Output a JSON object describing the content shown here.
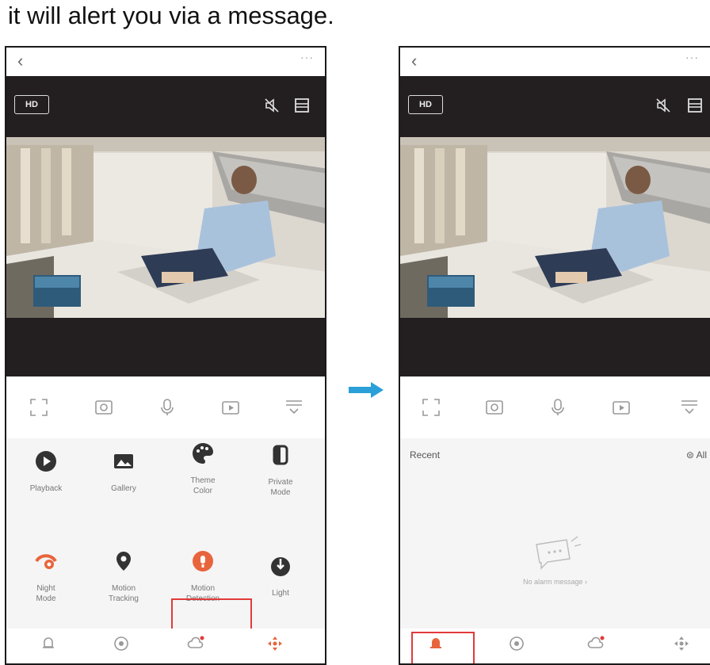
{
  "instruction": "it will alert you via a message.",
  "phone_left": {
    "back_glyph": "‹",
    "more_glyph": "···",
    "hd_label": "HD",
    "features": [
      {
        "label": "Playback",
        "icon": "play-circle-icon"
      },
      {
        "label": "Gallery",
        "icon": "image-icon"
      },
      {
        "label": "Theme\nColor",
        "icon": "palette-icon"
      },
      {
        "label": "Private\nMode",
        "icon": "half-circle-icon"
      },
      {
        "label": "Night\nMode",
        "icon": "eye-off-icon"
      },
      {
        "label": "Motion\nTracking",
        "icon": "location-pin-icon"
      },
      {
        "label": "Motion\nDetection",
        "icon": "motion-detection-icon"
      },
      {
        "label": "Light",
        "icon": "light-icon"
      }
    ]
  },
  "phone_right": {
    "back_glyph": "‹",
    "more_glyph": "···",
    "hd_label": "HD",
    "recent_label": "Recent",
    "all_label": "All",
    "empty_message": "No alarm message ›"
  },
  "colors": {
    "accent_orange": "#e8643c",
    "highlight_red": "#e23a3a",
    "arrow_blue": "#2a9fd8",
    "video_bar": "#231f20"
  }
}
